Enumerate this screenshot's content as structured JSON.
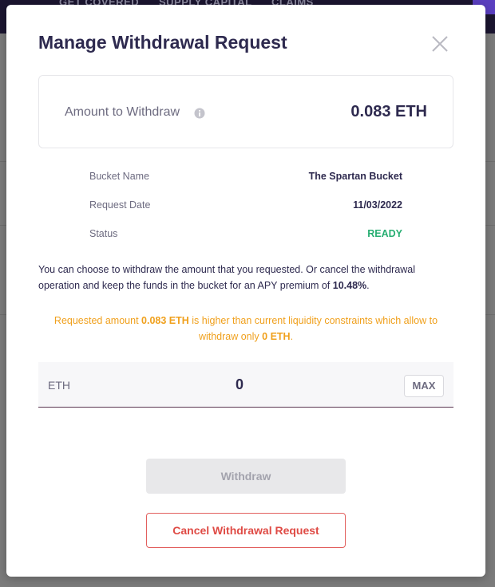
{
  "background": {
    "nav_items": [
      "GET COVERED",
      "SUPPLY CAPITAL",
      "CLAIMS"
    ]
  },
  "modal": {
    "title": "Manage Withdrawal Request",
    "close_icon": "close-icon",
    "amount_card": {
      "label": "Amount to Withdraw",
      "info_icon": "info-icon",
      "value": "0.083 ETH"
    },
    "details": [
      {
        "key": "Bucket Name",
        "value": "The Spartan Bucket"
      },
      {
        "key": "Request Date",
        "value": "11/03/2022"
      },
      {
        "key": "Status",
        "value": "READY"
      }
    ],
    "info": {
      "text_before": "You can choose to withdraw the amount that you requested. Or cancel the withdrawal operation and keep the funds in the bucket for an APY premium of ",
      "apy": "10.48%",
      "text_after": "."
    },
    "warning": {
      "part1": "Requested amount ",
      "requested": "0.083 ETH",
      "part2": " is higher than current liquidity constraints which allow to withdraw only ",
      "allowed": "0 ETH",
      "part3": "."
    },
    "eth_input": {
      "label": "ETH",
      "value": "0",
      "max_label": "MAX"
    },
    "withdraw_button": "Withdraw",
    "cancel_button": "Cancel Withdrawal Request"
  },
  "colors": {
    "title": "#2e2a4f",
    "ready": "#27ae72",
    "warning": "#f0a01c",
    "cancel": "#df4b45"
  }
}
